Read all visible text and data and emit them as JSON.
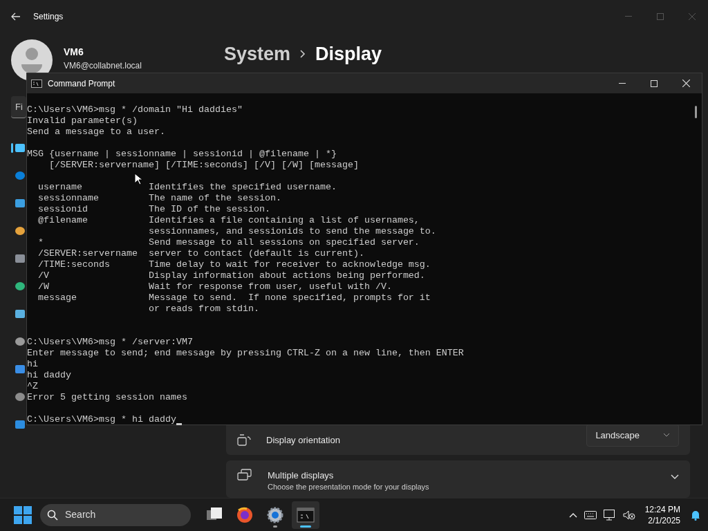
{
  "settings": {
    "title": "Settings",
    "user": {
      "name": "VM6",
      "email": "VM6@collabnet.local"
    },
    "search": {
      "value": "Fi"
    },
    "nav_items": [
      {
        "selected": true,
        "color": "#4cc2ff"
      },
      {
        "selected": false,
        "color": "#0a7fd8"
      },
      {
        "selected": false,
        "color": "#3b9ee0"
      },
      {
        "selected": false,
        "color": "#e5a23c"
      },
      {
        "selected": false,
        "color": "#8a8f98"
      },
      {
        "selected": false,
        "color": "#2fb67c"
      },
      {
        "selected": false,
        "color": "#5ab0e0"
      },
      {
        "selected": false,
        "color": "#9a9a9a"
      },
      {
        "selected": false,
        "color": "#3a8ee6"
      },
      {
        "selected": false,
        "color": "#8c8c8c"
      },
      {
        "selected": false,
        "color": "#2c8de0"
      }
    ],
    "breadcrumb": [
      "System",
      "Display"
    ],
    "orientation": {
      "label": "Display orientation",
      "value": "Landscape"
    },
    "multiple_displays": {
      "title": "Multiple displays",
      "subtitle": "Choose the presentation mode for your displays",
      "expanded": false
    }
  },
  "terminal": {
    "title": "Command Prompt",
    "cursor": true,
    "blocks": [
      {
        "kind": "output",
        "lines": [
          "C:\\Users\\VM6>msg * /domain \"Hi daddies\"",
          "Invalid parameter(s)",
          "Send a message to a user."
        ]
      },
      {
        "kind": "output",
        "lines": [
          "MSG {username | sessionname | sessionid | @filename | *}",
          "    [/SERVER:servername] [/TIME:seconds] [/V] [/W] [message]"
        ]
      },
      {
        "kind": "help",
        "lines": [
          "  username            Identifies the specified username.",
          "  sessionname         The name of the session.",
          "  sessionid           The ID of the session.",
          "  @filename           Identifies a file containing a list of usernames,",
          "                      sessionnames, and sessionids to send the message to.",
          "  *                   Send message to all sessions on specified server.",
          "  /SERVER:servername  server to contact (default is current).",
          "  /TIME:seconds       Time delay to wait for receiver to acknowledge msg.",
          "  /V                  Display information about actions being performed.",
          "  /W                  Wait for response from user, useful with /V.",
          "  message             Message to send.  If none specified, prompts for it",
          "                      or reads from stdin."
        ]
      },
      {
        "kind": "output",
        "lines": [
          "C:\\Users\\VM6>msg * /server:VM7",
          "Enter message to send; end message by pressing CTRL-Z on a new line, then ENTER",
          "hi",
          "hi daddy",
          "^Z",
          "Error 5 getting session names"
        ]
      },
      {
        "kind": "output",
        "lines": [
          "C:\\Users\\VM6>msg * hi daddy"
        ]
      }
    ]
  },
  "taskbar": {
    "search": {
      "placeholder": "Search"
    },
    "apps": [
      {
        "kind": "taskview",
        "active": false,
        "running": false
      },
      {
        "kind": "firefox",
        "active": false,
        "running": false
      },
      {
        "kind": "settings",
        "active": false,
        "running": true
      },
      {
        "kind": "cmd",
        "active": true,
        "running": true
      }
    ],
    "clock": {
      "time": "12:24 PM",
      "date": "2/1/2025"
    }
  }
}
